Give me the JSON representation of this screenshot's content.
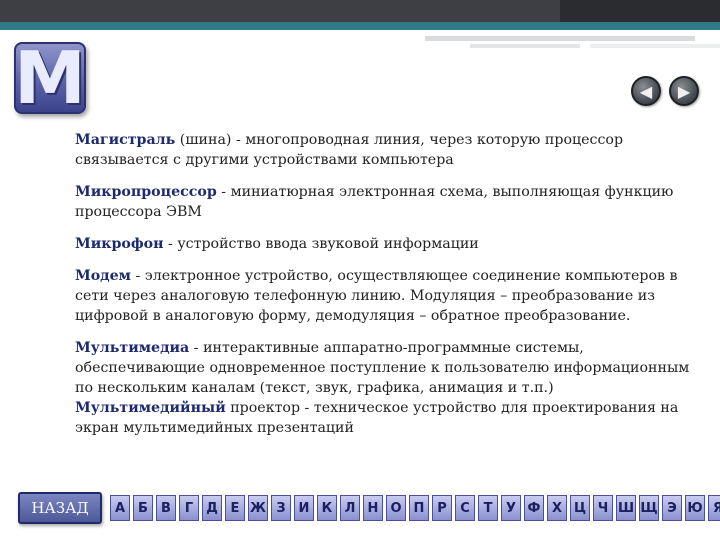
{
  "header": {
    "letter": "М"
  },
  "nav": {
    "prev_icon": "arrow-left-icon",
    "next_icon": "arrow-right-icon",
    "prev_glyph": "◀",
    "next_glyph": "▶"
  },
  "entries": [
    {
      "term": "Магистраль",
      "text": " (шина) - многопроводная линия, через которую процессор связывается с другими устройствами компьютера"
    },
    {
      "term": "Микропроцессор",
      "text": " - миниатюрная электронная схема, выполняющая функцию процессора ЭВМ"
    },
    {
      "term": "Микрофон",
      "text": " - устройство ввода звуковой информации"
    },
    {
      "term": "Модем",
      "text": " - электронное устройство, осуществляющее соединение компьютеров в сети через аналоговую телефонную линию. Модуляция – преобразование из цифровой в аналоговую форму, демодуляция – обратное преобразование."
    },
    {
      "term": "Мультимедиа",
      "text": " - интерактивные аппаратно-программные системы, обеспечивающие одновременное поступление к пользователю информационным по нескольким каналам (текст, звук, графика, анимация и т.п.)"
    },
    {
      "term": "Мультимедийный",
      "text": " проектор - техническое устройство для проектирования на экран мультимедийных презентаций"
    }
  ],
  "footer": {
    "back_label": "НАЗАД",
    "alphabet": [
      "А",
      "Б",
      "В",
      "Г",
      "Д",
      "Е",
      "Ж",
      "З",
      "И",
      "К",
      "Л",
      "Н",
      "О",
      "П",
      "Р",
      "С",
      "Т",
      "У",
      "Ф",
      "Х",
      "Ц",
      "Ч",
      "Ш",
      "Щ",
      "Э",
      "Ю",
      "Я"
    ]
  }
}
